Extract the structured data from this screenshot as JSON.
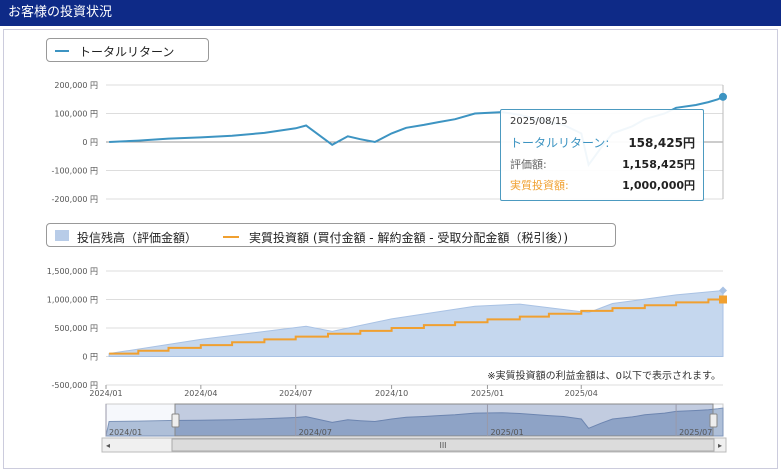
{
  "header": {
    "title": "お客様の投資状況"
  },
  "top_legend": {
    "return_label": "トータルリターン"
  },
  "bottom_legend": {
    "balance_label": "投信残高（評価金額）",
    "invested_label": "実質投資額 (買付金額 - 解約金額 - 受取分配金額（税引後）)"
  },
  "tooltip": {
    "date": "2025/08/15",
    "return_label": "トータルリターン:",
    "return_value": "158,425円",
    "valuation_label": "評価額:",
    "valuation_value": "1,158,425円",
    "invested_label": "実質投資額:",
    "invested_value": "1,000,000円"
  },
  "note": "※実質投資額の利益金額は、0以下で表示されます。",
  "colors": {
    "return": "#3d94c2",
    "balance_fill": "#c5d7ee",
    "invested": "#f0a030",
    "header": "#0e2a87"
  },
  "navigator": {
    "x_labels": [
      "2024/01",
      "2024/07",
      "2025/01",
      "2025/07"
    ],
    "scrollbar_grip": "III",
    "left_arrow": "◂",
    "right_arrow": "▸"
  },
  "chart_data": [
    {
      "type": "line",
      "name": "total-return",
      "ylim": [
        -200000,
        200000
      ],
      "y_ticks": [
        "200,000 円",
        "100,000 円",
        "0 円",
        "-100,000 円",
        "-200,000 円"
      ],
      "y_tick_values": [
        200000,
        100000,
        0,
        -100000,
        -200000
      ],
      "x_range": [
        "2024-01-01",
        "2025-08-15"
      ],
      "series": [
        {
          "name": "トータルリターン",
          "x": [
            "2024-01-04",
            "2024-02-01",
            "2024-03-01",
            "2024-04-01",
            "2024-05-01",
            "2024-06-01",
            "2024-07-01",
            "2024-07-11",
            "2024-08-05",
            "2024-08-20",
            "2024-09-01",
            "2024-09-15",
            "2024-10-01",
            "2024-10-15",
            "2024-11-01",
            "2024-11-15",
            "2024-12-01",
            "2024-12-20",
            "2025-01-15",
            "2025-02-01",
            "2025-03-01",
            "2025-03-15",
            "2025-04-01",
            "2025-04-08",
            "2025-04-20",
            "2025-05-01",
            "2025-05-20",
            "2025-06-01",
            "2025-06-20",
            "2025-07-01",
            "2025-07-20",
            "2025-08-01",
            "2025-08-10",
            "2025-08-15"
          ],
          "y": [
            0,
            5000,
            12000,
            16000,
            22000,
            32000,
            48000,
            58000,
            -10000,
            20000,
            10000,
            0,
            30000,
            50000,
            60000,
            70000,
            80000,
            100000,
            105000,
            95000,
            70000,
            60000,
            30000,
            -80000,
            -20000,
            30000,
            55000,
            80000,
            100000,
            120000,
            130000,
            140000,
            150000,
            158425
          ]
        }
      ]
    },
    {
      "type": "area",
      "name": "balance-vs-invested",
      "ylim": [
        -500000,
        1500000
      ],
      "y_ticks": [
        "1,500,000 円",
        "1,000,000 円",
        "500,000 円",
        "0 円",
        "-500,000 円"
      ],
      "y_tick_values": [
        1500000,
        1000000,
        500000,
        0,
        -500000
      ],
      "x_ticks": [
        "2024/01",
        "2024/04",
        "2024/07",
        "2024/10",
        "2025/01",
        "2025/04"
      ],
      "x_tick_dates": [
        "2024-01-01",
        "2024-04-01",
        "2024-07-01",
        "2024-10-01",
        "2025-01-01",
        "2025-04-01"
      ],
      "x_range": [
        "2024-01-01",
        "2025-08-15"
      ],
      "series": [
        {
          "name": "投信残高（評価金額）",
          "x": [
            "2024-01-04",
            "2024-04-01",
            "2024-07-11",
            "2024-08-05",
            "2024-10-01",
            "2024-12-20",
            "2025-02-01",
            "2025-04-08",
            "2025-05-01",
            "2025-07-01",
            "2025-08-15"
          ],
          "y": [
            50000,
            300000,
            530000,
            440000,
            660000,
            880000,
            920000,
            770000,
            930000,
            1080000,
            1158425
          ]
        },
        {
          "name": "実質投資額 (買付金額 - 解約金額 - 受取分配金額（税引後）)",
          "step": true,
          "x": [
            "2024-01-04",
            "2024-02-01",
            "2024-03-01",
            "2024-04-01",
            "2024-05-01",
            "2024-06-01",
            "2024-07-01",
            "2024-08-01",
            "2024-09-01",
            "2024-10-01",
            "2024-11-01",
            "2024-12-01",
            "2025-01-01",
            "2025-02-01",
            "2025-03-01",
            "2025-04-01",
            "2025-05-01",
            "2025-06-01",
            "2025-07-01",
            "2025-08-01",
            "2025-08-15"
          ],
          "y": [
            50000,
            100000,
            150000,
            200000,
            250000,
            300000,
            350000,
            400000,
            450000,
            500000,
            550000,
            600000,
            650000,
            700000,
            750000,
            800000,
            850000,
            900000,
            950000,
            1000000,
            1000000
          ]
        }
      ]
    }
  ]
}
